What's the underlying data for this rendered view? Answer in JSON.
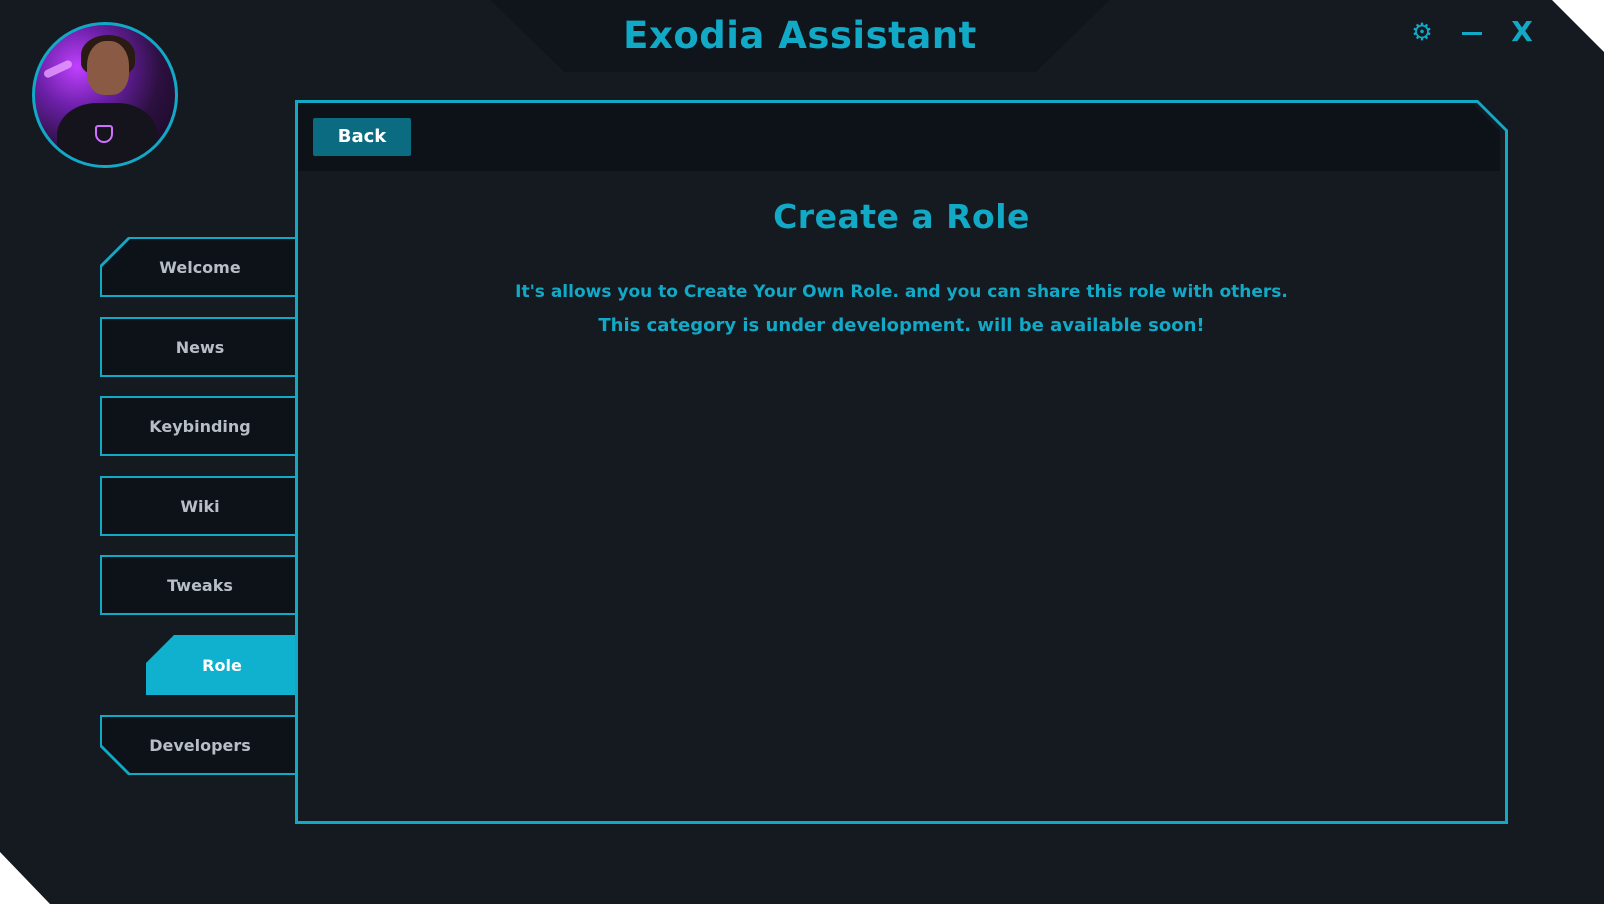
{
  "app": {
    "title": "Exodia Assistant",
    "accent_color": "#12a9c7",
    "window_controls": {
      "settings_icon": "gear-icon",
      "minimize_icon": "minimize-icon",
      "close_label": "X"
    }
  },
  "sidebar": {
    "avatar": "user-avatar",
    "items": [
      {
        "label": "Welcome"
      },
      {
        "label": "News"
      },
      {
        "label": "Keybinding"
      },
      {
        "label": "Wiki"
      },
      {
        "label": "Tweaks"
      },
      {
        "label": "Role",
        "active": true
      },
      {
        "label": "Developers"
      }
    ]
  },
  "main": {
    "back_label": "Back",
    "title": "Create a Role",
    "description_1": "It's allows you to Create Your Own Role. and you can share this role with others.",
    "description_2": "This category is under development. will be available soon!"
  }
}
